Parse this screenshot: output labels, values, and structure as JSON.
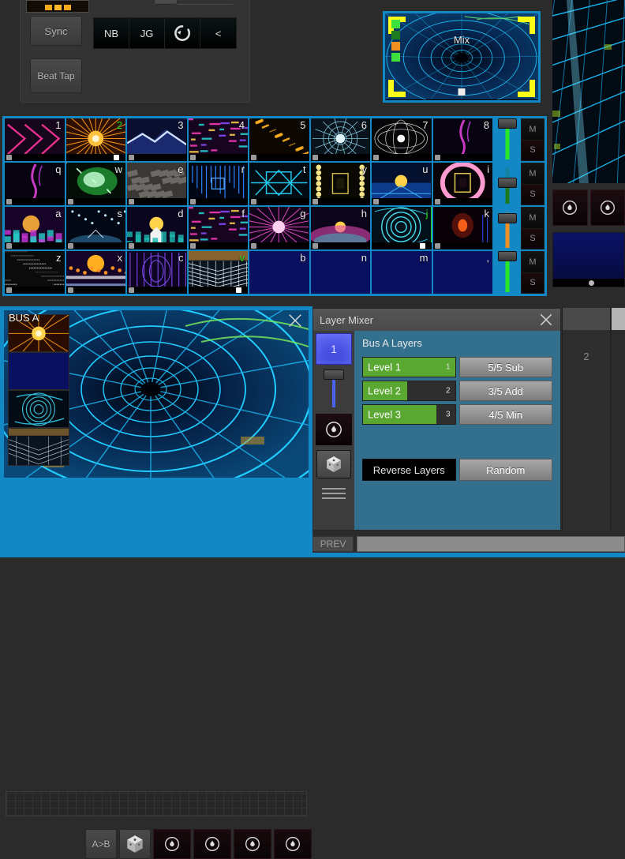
{
  "transport": {
    "sync_label": "Sync",
    "beat_tap_label": "Beat Tap",
    "buttons": [
      "NB",
      "JG",
      "↺",
      "<"
    ],
    "thumb_icon": "clip-thumbnail-icon"
  },
  "mix_preview": {
    "label": "Mix",
    "indicator_colors": [
      "#3de03d",
      "#1e7a1e",
      "#f09020",
      "#3de03d"
    ],
    "frame_color": "#fbfb18",
    "border_color": "#1288c4"
  },
  "grid": {
    "rows": [
      {
        "fader": {
          "color": "#28e828",
          "value": 100
        },
        "mute_label": "M",
        "solo_label": "S",
        "cells": [
          {
            "key": "1",
            "selected": false,
            "empty": false,
            "art": "chevrons-magenta"
          },
          {
            "key": "2",
            "selected": true,
            "empty": false,
            "art": "sunburst-orange"
          },
          {
            "key": "3",
            "selected": false,
            "empty": false,
            "art": "mountain-blue"
          },
          {
            "key": "4",
            "selected": false,
            "empty": false,
            "art": "glitch-pink"
          },
          {
            "key": "5",
            "selected": false,
            "empty": false,
            "art": "sparks-gold"
          },
          {
            "key": "6",
            "selected": false,
            "empty": false,
            "art": "web-cyan"
          },
          {
            "key": "7",
            "selected": false,
            "empty": false,
            "art": "mandala-white"
          },
          {
            "key": "8",
            "selected": false,
            "empty": false,
            "art": "wisp-magenta"
          }
        ]
      },
      {
        "fader": {
          "color": "#1c7a1c",
          "value": 55
        },
        "mute_label": "M",
        "solo_label": "S",
        "cells": [
          {
            "key": "q",
            "selected": false,
            "empty": false,
            "art": "wisp-magenta"
          },
          {
            "key": "w",
            "selected": false,
            "empty": false,
            "art": "nebula-green"
          },
          {
            "key": "e",
            "selected": false,
            "empty": false,
            "art": "concrete-gray"
          },
          {
            "key": "r",
            "selected": false,
            "empty": false,
            "art": "circuit-blue"
          },
          {
            "key": "t",
            "selected": false,
            "empty": false,
            "art": "wire-cyan"
          },
          {
            "key": "y",
            "selected": false,
            "empty": false,
            "art": "corridor-gold"
          },
          {
            "key": "u",
            "selected": false,
            "empty": false,
            "art": "sunset-blue"
          },
          {
            "key": "i",
            "selected": false,
            "empty": false,
            "art": "portal-pink"
          }
        ]
      },
      {
        "fader": {
          "color": "#f09020",
          "value": 80
        },
        "mute_label": "M",
        "solo_label": "S",
        "cells": [
          {
            "key": "a",
            "selected": false,
            "empty": false,
            "art": "city-purple"
          },
          {
            "key": "s",
            "selected": false,
            "empty": false,
            "art": "night-stars"
          },
          {
            "key": "d",
            "selected": false,
            "empty": false,
            "art": "sunset-teal"
          },
          {
            "key": "f",
            "selected": false,
            "empty": false,
            "art": "glitch-pink"
          },
          {
            "key": "g",
            "selected": false,
            "empty": false,
            "art": "burst-magenta"
          },
          {
            "key": "h",
            "selected": false,
            "empty": false,
            "art": "horizon-pink"
          },
          {
            "key": "j",
            "selected": true,
            "empty": false,
            "art": "spiral-cyan"
          },
          {
            "key": "k",
            "selected": false,
            "empty": false,
            "art": "lamp-red"
          }
        ]
      },
      {
        "fader": {
          "color": "#28e828",
          "value": 100
        },
        "mute_label": "M",
        "solo_label": "S",
        "cells": [
          {
            "key": "z",
            "selected": false,
            "empty": false,
            "art": "noise-white"
          },
          {
            "key": "x",
            "selected": false,
            "empty": false,
            "art": "moon-orange"
          },
          {
            "key": "c",
            "selected": false,
            "empty": false,
            "art": "symmetry-violet"
          },
          {
            "key": "v",
            "selected": true,
            "empty": false,
            "art": "tunnel-white"
          },
          {
            "key": "b",
            "selected": false,
            "empty": true,
            "art": ""
          },
          {
            "key": "n",
            "selected": false,
            "empty": true,
            "art": ""
          },
          {
            "key": "m",
            "selected": false,
            "empty": true,
            "art": ""
          },
          {
            "key": ",",
            "selected": false,
            "empty": true,
            "art": ""
          }
        ]
      }
    ]
  },
  "bus": {
    "label": "BUS A",
    "close_icon": "close-icon",
    "layer_thumbs": [
      "sunburst-orange",
      "empty-blue",
      "spiral-cyan",
      "tunnel-white"
    ],
    "buttons": {
      "ab_label": "A>B",
      "dice_icon": "dice-icon",
      "flame_icon": "flame-icon",
      "flame_count": 4
    }
  },
  "layer_mixer": {
    "title": "Layer Mixer",
    "close_icon": "close-icon",
    "deck_number": "1",
    "heading": "Bus A Layers",
    "side_icons": [
      "flame-icon",
      "dice-icon",
      "menu-icon"
    ],
    "levels": [
      {
        "name": "Level 1",
        "num": "1",
        "value": 100,
        "blend": "5/5 Sub"
      },
      {
        "name": "Level 2",
        "num": "2",
        "value": 48,
        "blend": "3/5 Add"
      },
      {
        "name": "Level 3",
        "num": "3",
        "value": 80,
        "blend": "4/5 Min"
      }
    ],
    "reverse_label": "Reverse Layers",
    "random_label": "Random",
    "level_fill_color": "#5aa832"
  },
  "right_deck": {
    "number": "2"
  },
  "prev_bar": {
    "label": "PREV"
  },
  "right_preview": {
    "flame_icon": "flame-icon",
    "flame_count": 2
  },
  "colors": {
    "accent_blue": "#1288c4",
    "panel_teal": "#32708e",
    "green_select": "#22e022",
    "yellow_frame": "#fbfb18",
    "background": "#2b2b2b"
  }
}
